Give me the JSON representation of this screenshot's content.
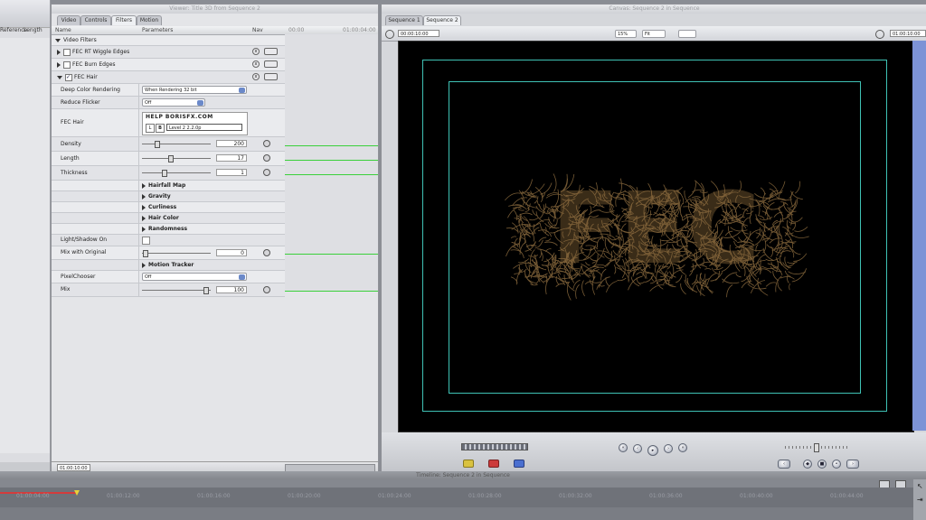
{
  "browser": {
    "col1": "Reference",
    "col2": "Length"
  },
  "viewer": {
    "title": "Viewer: Title 3D from Sequence 2",
    "tabs": [
      "Video",
      "Controls",
      "Filters",
      "Motion"
    ],
    "selected_tab": "Filters",
    "columns": {
      "name": "Name",
      "parameters": "Parameters",
      "nav": "Nav"
    },
    "ruler_start": "00:00",
    "ruler_end": "01:00:04:00",
    "section": "Video Filters",
    "filters": [
      {
        "name": "FEC RT Wiggle Edges",
        "enabled": false
      },
      {
        "name": "FEC Burn Edges",
        "enabled": false
      },
      {
        "name": "FEC Hair",
        "enabled": true
      }
    ],
    "params": {
      "deep_color_label": "Deep Color Rendering",
      "deep_color_value": "When Rendering 32 bit",
      "reduce_flicker_label": "Reduce Flicker",
      "reduce_flicker_value": "Off",
      "fec_hair_label": "FEC Hair",
      "help_text": "HELP  BORISFX.COM",
      "version_text": "Level 2 2.2.0p",
      "density_label": "Density",
      "density_value": "200",
      "density_fraction": 0.2,
      "length_label": "Length",
      "length_value": "17",
      "length_fraction": 0.4,
      "thickness_label": "Thickness",
      "thickness_value": "1",
      "thickness_fraction": 0.3,
      "groups": [
        "Hairfall Map",
        "Gravity",
        "Curliness",
        "Hair Color",
        "Randomness"
      ],
      "light_shadow_label": "Light/Shadow On",
      "mix_original_label": "Mix with Original",
      "mix_original_value": "0",
      "motion_tracker_label": "Motion Tracker",
      "pixel_chooser_label": "PixelChooser",
      "pixel_chooser_value": "Off",
      "mix_label": "Mix",
      "mix_value": "100",
      "mix_fraction": 0.95
    },
    "footer_timecode": "01:00:10:00"
  },
  "canvas": {
    "title": "Canvas: Sequence 2 in Sequence",
    "tabs": [
      "Sequence 1",
      "Sequence 2"
    ],
    "selected_tab": "Sequence 2",
    "timecode_left": "00:00:10:00",
    "timecode_right": "01:00:10:00",
    "zoom": "15%",
    "fit": "Fit",
    "render_text": "FEC",
    "hair_color": "#8a6a3e"
  },
  "timeline": {
    "title": "Timeline: Sequence 2 in Sequence",
    "ticks": [
      "01:00:04:00",
      "01:00:12:00",
      "01:00:16:00",
      "01:00:20:00",
      "01:00:24:00",
      "01:00:28:00",
      "01:00:32:00",
      "01:00:36:00",
      "01:00:40:00",
      "01:00:44:00"
    ]
  },
  "colors": {
    "title_safe": "#3fc2b5",
    "slider_track_green": "#3ad03a"
  }
}
